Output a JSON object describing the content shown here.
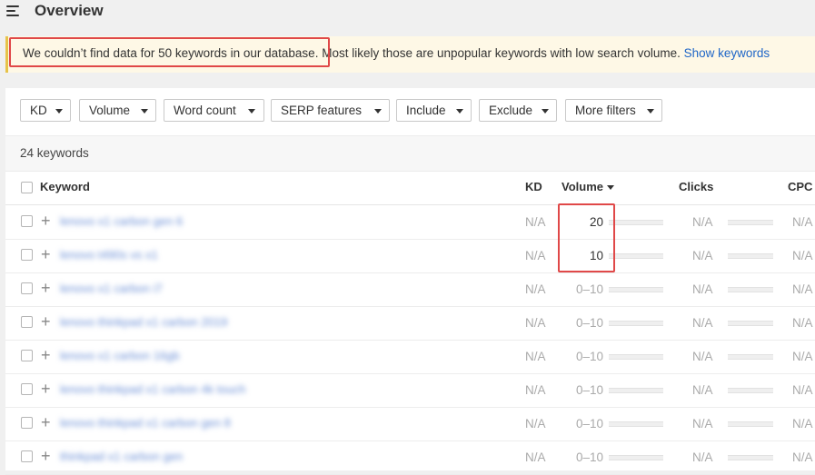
{
  "header": {
    "title": "Overview",
    "menu_icon": "hamburger-menu-icon"
  },
  "notice": {
    "highlight_text": "We couldn’t find data for 50 keywords in our database.",
    "rest_text": " Most likely those are unpopular keywords with low search volume. ",
    "link": "Show keywords"
  },
  "filters": [
    "KD",
    "Volume",
    "Word count",
    "SERP features",
    "Include",
    "Exclude",
    "More filters"
  ],
  "summary": {
    "count_text": "24 keywords"
  },
  "table": {
    "columns": {
      "keyword": "Keyword",
      "kd": "KD",
      "volume": "Volume",
      "clicks": "Clicks",
      "cpc": "CPC"
    },
    "sort": {
      "column": "Volume",
      "direction": "desc"
    },
    "rows": [
      {
        "keyword": "lenovo x1 carbon gen 6",
        "kd": "N/A",
        "volume": "20",
        "clicks": "N/A",
        "cpc": "N/A"
      },
      {
        "keyword": "lenovo t490s vs x1",
        "kd": "N/A",
        "volume": "10",
        "clicks": "N/A",
        "cpc": "N/A"
      },
      {
        "keyword": "lenovo x1 carbon i7",
        "kd": "N/A",
        "volume": "0–10",
        "clicks": "N/A",
        "cpc": "N/A"
      },
      {
        "keyword": "lenovo thinkpad x1 carbon 2019",
        "kd": "N/A",
        "volume": "0–10",
        "clicks": "N/A",
        "cpc": "N/A"
      },
      {
        "keyword": "lenovo x1 carbon 16gb",
        "kd": "N/A",
        "volume": "0–10",
        "clicks": "N/A",
        "cpc": "N/A"
      },
      {
        "keyword": "lenovo thinkpad x1 carbon 4k touch",
        "kd": "N/A",
        "volume": "0–10",
        "clicks": "N/A",
        "cpc": "N/A"
      },
      {
        "keyword": "lenovo thinkpad x1 carbon gen 8",
        "kd": "N/A",
        "volume": "0–10",
        "clicks": "N/A",
        "cpc": "N/A"
      },
      {
        "keyword": "thinkpad x1 carbon gen",
        "kd": "N/A",
        "volume": "0–10",
        "clicks": "N/A",
        "cpc": "N/A"
      }
    ]
  },
  "colors": {
    "annotation_box": "#e04848",
    "notice_bg": "#fef8e6",
    "link": "#1f66c7"
  }
}
